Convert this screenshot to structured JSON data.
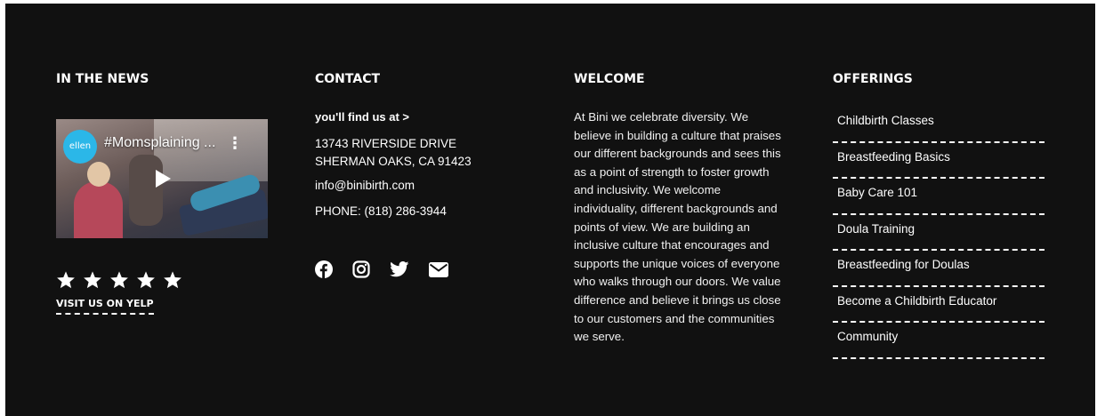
{
  "colors": {
    "background": "#111111",
    "text": "#ffffff",
    "ellen_blue": "#2bb7e8"
  },
  "news": {
    "heading": "IN THE NEWS",
    "video": {
      "logo": "ellen",
      "title": "#Momsplaining ...",
      "icons": [
        "play-icon",
        "more-vertical-icon"
      ]
    },
    "rating": {
      "stars": 5,
      "max": 5
    },
    "yelp_link": "VISIT US ON YELP"
  },
  "contact": {
    "heading": "CONTACT",
    "find_label": "you'll find us at >",
    "address_line1": "13743 RIVERSIDE DRIVE",
    "address_line2": "SHERMAN OAKS, CA 91423",
    "email": "info@binibirth.com",
    "phone": "PHONE: (818) 286-3944",
    "social": [
      "facebook-icon",
      "instagram-icon",
      "twitter-icon",
      "email-icon"
    ]
  },
  "welcome": {
    "heading": "WELCOME",
    "text": "At Bini we celebrate diversity. We believe in building a culture that praises our different backgrounds and sees this as a point of strength to foster growth and inclusivity. We welcome individuality, different backgrounds and points of view. We are building an inclusive culture that encourages and supports the unique voices of everyone who walks through our doors. We value difference and believe it brings us close to our customers and the communities we serve."
  },
  "offerings": {
    "heading": "OFFERINGS",
    "items": [
      "Childbirth Classes",
      "Breastfeeding Basics",
      "Baby Care 101",
      "Doula Training",
      "Breastfeeding for Doulas",
      "Become a Childbirth Educator",
      "Community"
    ]
  }
}
